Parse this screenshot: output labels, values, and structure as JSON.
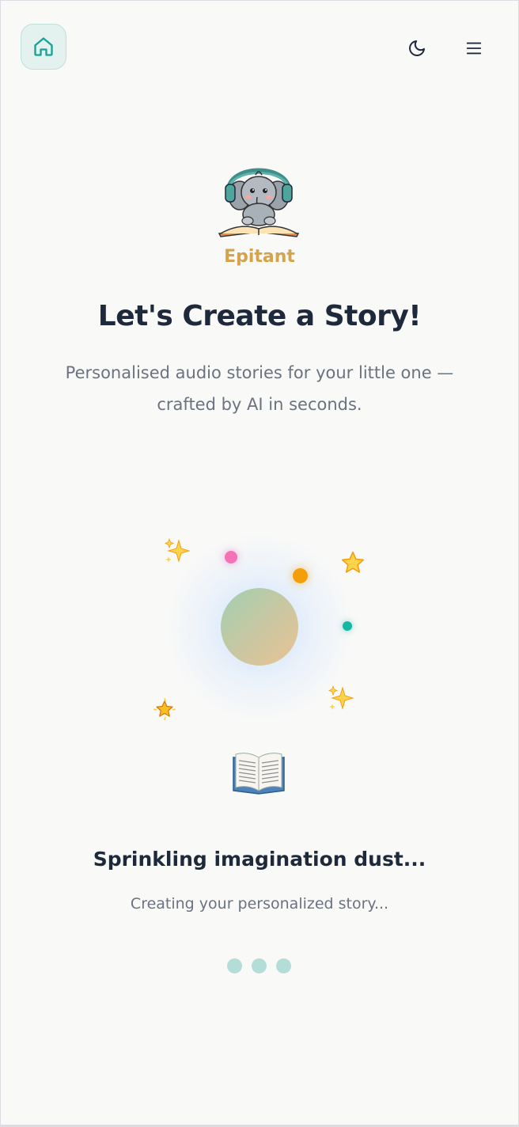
{
  "header": {
    "home_icon": "home-icon",
    "theme_icon": "moon-icon",
    "menu_icon": "hamburger-menu-icon"
  },
  "logo": {
    "text": "Epitant"
  },
  "hero": {
    "title": "Let's Create a Story!",
    "subtitle": "Personalised audio stories for your little one — crafted by AI in seconds."
  },
  "loading": {
    "title": "Sprinkling imagination dust...",
    "subtitle": "Creating your personalized story...",
    "book_icon": "open-book-icon",
    "sparkles": [
      "✨",
      "⭐",
      "✨",
      "🌟"
    ]
  },
  "colors": {
    "accent": "#14b8a6",
    "text_dark": "#1e293b",
    "text_muted": "#6b7280",
    "background": "#f9f9f8"
  }
}
